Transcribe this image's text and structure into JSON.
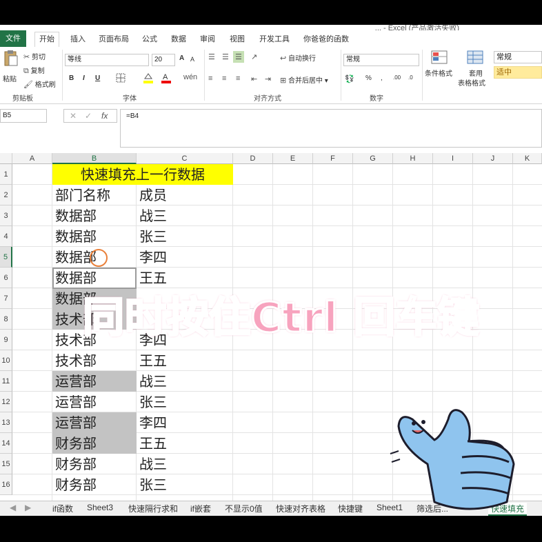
{
  "window": {
    "title": "... - Excel (产品激活失败)"
  },
  "ribbon_tabs": [
    "文件",
    "开始",
    "插入",
    "页面布局",
    "公式",
    "数据",
    "审阅",
    "视图",
    "开发工具",
    "你爸爸的函数"
  ],
  "clipboard": {
    "paste": "粘贴",
    "cut": "剪切",
    "copy": "复制",
    "format_painter": "格式刷",
    "group": "剪贴板"
  },
  "font": {
    "name": "等线",
    "size": "20",
    "bold": "B",
    "italic": "I",
    "underline": "U",
    "grow": "A",
    "shrink": "A",
    "group": "字体"
  },
  "alignment": {
    "wrap": "自动换行",
    "merge": "合并后居中",
    "group": "对齐方式"
  },
  "number": {
    "format": "常规",
    "percent": "%",
    "comma": ",",
    "group": "数字"
  },
  "styles": {
    "conditional": "条件格式",
    "table_l1": "套用",
    "table_l2": "表格格式",
    "style_normal": "常规",
    "style_neutral": "适中"
  },
  "formula_bar": {
    "name_box": "B5",
    "formula": "=B4",
    "fx": "fx"
  },
  "columns": [
    "A",
    "B",
    "C",
    "D",
    "E",
    "F",
    "G",
    "H",
    "I",
    "J",
    "K"
  ],
  "rows": [
    "1",
    "2",
    "3",
    "4",
    "5",
    "6",
    "7",
    "8",
    "9",
    "10",
    "11",
    "12",
    "13",
    "14",
    "15",
    "16"
  ],
  "sheet": {
    "title": "快速填充上一行数据",
    "header_b": "部门名称",
    "header_c": "成员",
    "b": [
      "数据部",
      "数据部",
      "数据部",
      "数据部",
      "数据部",
      "技术部",
      "技术部",
      "技术部",
      "运营部",
      "运营部",
      "运营部",
      "财务部",
      "财务部",
      "财务部"
    ],
    "c": [
      "战三",
      "张三",
      "李四",
      "王五",
      "",
      "",
      "李四",
      "王五",
      "战三",
      "张三",
      "李四",
      "王五",
      "战三",
      "张三"
    ]
  },
  "sheet_tabs": [
    "if函数",
    "Sheet3",
    "快速隔行求和",
    "if嵌套",
    "不显示0值",
    "快速对齐表格",
    "快捷键",
    "Sheet1",
    "筛选后...",
    "快速填充"
  ],
  "overlay": {
    "caption": "同时按住Ctrl 回车键"
  },
  "colors": {
    "excel_green": "#217346",
    "title_fill": "#ffff00",
    "selection_shade": "#c3c3c3",
    "caption_pink": "#f7a3be"
  }
}
